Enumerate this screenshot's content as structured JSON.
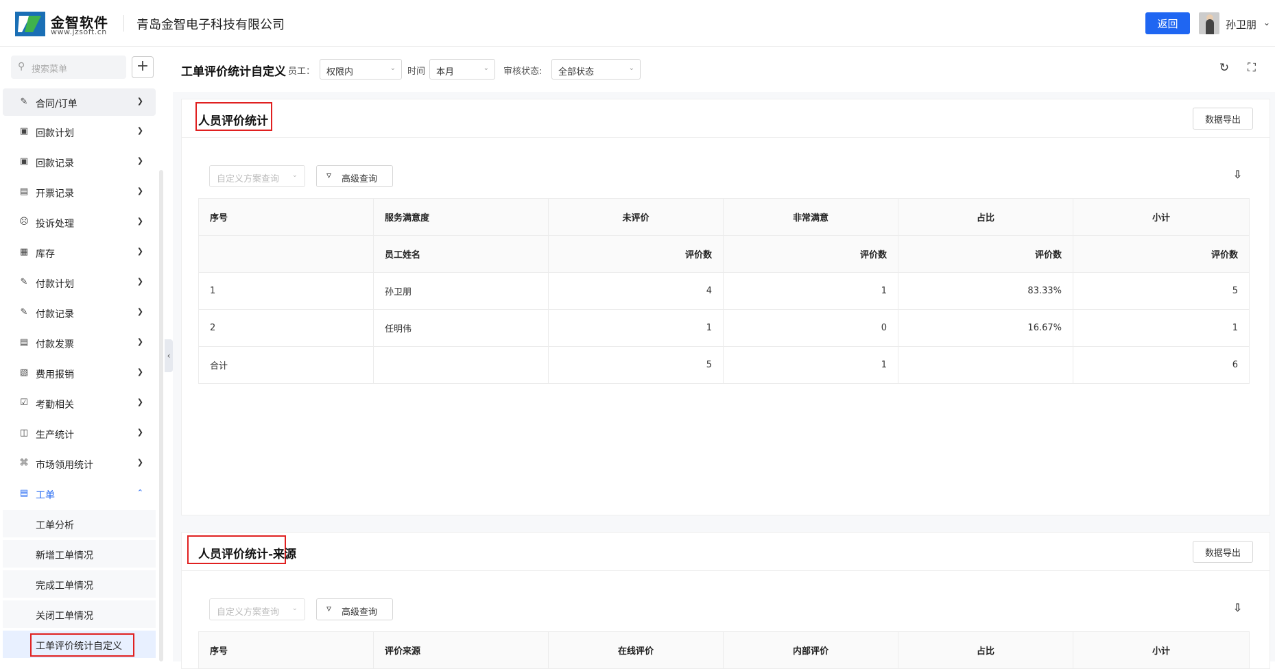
{
  "header": {
    "logo_text": "金智软件",
    "logo_url": "www.jzsoft.cn",
    "company": "青岛金智电子科技有限公司",
    "back_label": "返回",
    "user_name": "孙卫朋"
  },
  "sidebar": {
    "search_placeholder": "搜索菜单",
    "add_label": "+",
    "items": [
      {
        "label": "合同/订单",
        "icon": "contract-icon"
      },
      {
        "label": "回款计划",
        "icon": "plan-icon"
      },
      {
        "label": "回款记录",
        "icon": "record-icon"
      },
      {
        "label": "开票记录",
        "icon": "invoice-icon"
      },
      {
        "label": "投诉处理",
        "icon": "complaint-icon"
      },
      {
        "label": "库存",
        "icon": "inventory-icon"
      },
      {
        "label": "付款计划",
        "icon": "payment-plan-icon"
      },
      {
        "label": "付款记录",
        "icon": "payment-record-icon"
      },
      {
        "label": "付款发票",
        "icon": "payment-invoice-icon"
      },
      {
        "label": "费用报销",
        "icon": "expense-icon"
      },
      {
        "label": "考勤相关",
        "icon": "attendance-icon"
      },
      {
        "label": "生产统计",
        "icon": "production-icon"
      },
      {
        "label": "市场领用统计",
        "icon": "market-icon"
      },
      {
        "label": "工单",
        "icon": "workorder-icon"
      }
    ],
    "sub_items": [
      "工单分析",
      "新增工单情况",
      "完成工单情况",
      "关闭工单情况",
      "工单评价统计自定义"
    ]
  },
  "toolbar": {
    "title": "工单评价统计自定义",
    "employee_label": "员工：",
    "employee_value": "权限内",
    "time_label": "时间",
    "time_value": "本月",
    "audit_label": "审核状态:",
    "audit_value": "全部状态"
  },
  "card1": {
    "title": "人员评价统计",
    "export_label": "数据导出",
    "plan_placeholder": "自定义方案查询",
    "adv_label": "高级查询",
    "headers1": [
      "序号",
      "服务满意度",
      "未评价",
      "非常满意",
      "占比",
      "小计"
    ],
    "headers2": [
      "",
      "员工姓名",
      "评价数",
      "评价数",
      "评价数",
      "评价数"
    ],
    "rows": [
      {
        "no": "1",
        "name": "孙卫朋",
        "unrated": "4",
        "very": "1",
        "ratio": "83.33%",
        "subtotal": "5"
      },
      {
        "no": "2",
        "name": "任明伟",
        "unrated": "1",
        "very": "0",
        "ratio": "16.67%",
        "subtotal": "1"
      }
    ],
    "total": {
      "label": "合计",
      "name": "",
      "unrated": "5",
      "very": "1",
      "ratio": "",
      "subtotal": "6"
    }
  },
  "card2": {
    "title": "人员评价统计-来源",
    "export_label": "数据导出",
    "plan_placeholder": "自定义方案查询",
    "adv_label": "高级查询",
    "headers1": [
      "序号",
      "评价来源",
      "在线评价",
      "内部评价",
      "占比",
      "小计"
    ]
  }
}
